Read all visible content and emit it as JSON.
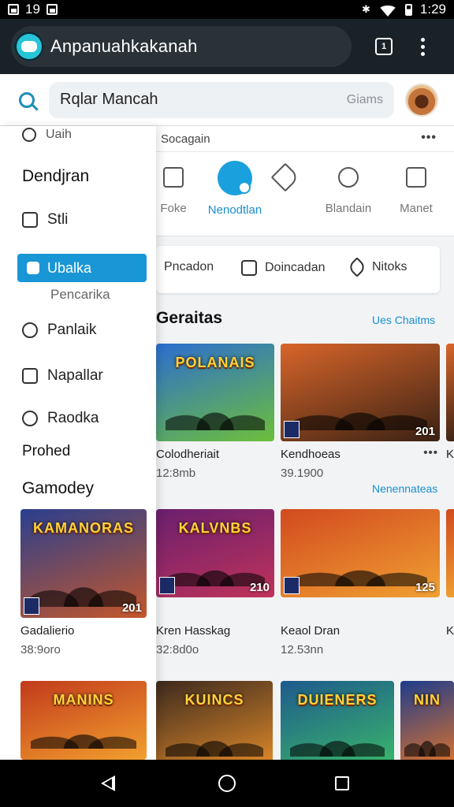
{
  "status_bar": {
    "time_left": "19",
    "time_right": "1:29"
  },
  "app_bar": {
    "title": "Anpanuahkakanah",
    "tab_count": "1"
  },
  "search": {
    "query": "Rqlar Mancah",
    "scope": "Giams"
  },
  "drawer": {
    "top_item": "Uaih",
    "heading1": "Dendjran",
    "item_stli": "Stli",
    "active_item": "Ubalka",
    "sub_item": "Pencarika",
    "item_panlaik": "Panlaik",
    "item_napallar": "Napallar",
    "item_raodka": "Raodka",
    "heading2": "Prohed",
    "section": "Gamodey"
  },
  "quick_card": {
    "title": "Socagain",
    "actions": [
      "Foke",
      "Nenodtlan",
      "",
      "Blandain",
      "Manet"
    ]
  },
  "chips": [
    "Pncadon",
    "Doincadan",
    "Nitoks"
  ],
  "featured": {
    "title": "Geraitas",
    "link": "Ues Chaitms",
    "sub_link": "Nenennateas"
  },
  "games": [
    {
      "art_title": "POLANAIS",
      "year": "",
      "name": "Colodheriait",
      "meta": "12:8mb",
      "colors": [
        "#2d6ed0",
        "#6cbf3a"
      ]
    },
    {
      "art_title": "",
      "year": "201",
      "name": "Kendhoeas",
      "meta": "39.1900",
      "colors": [
        "#d8652a",
        "#3a2214"
      ]
    },
    {
      "art_title": "KAMANORAS",
      "year": "201",
      "name": "Gadalierio",
      "meta": "38:9oro",
      "colors": [
        "#2a3f8f",
        "#c4572a"
      ]
    },
    {
      "art_title": "KALVNBS",
      "year": "210",
      "name": "Kren Hasskag",
      "meta": "32:8d0o",
      "colors": [
        "#6a1f6e",
        "#c0335a"
      ]
    },
    {
      "art_title": "",
      "year": "125",
      "name": "Keaol Dran",
      "meta": "12.53nn",
      "colors": [
        "#d24a1f",
        "#f0a032"
      ]
    },
    {
      "art_title": "MANINS",
      "year": "",
      "name": "",
      "meta": "",
      "colors": [
        "#c23a1c",
        "#f2a02e"
      ]
    },
    {
      "art_title": "KUINCS",
      "year": "",
      "name": "",
      "meta": "",
      "colors": [
        "#3c2a1e",
        "#e08a2a"
      ]
    },
    {
      "art_title": "DUIENERS",
      "year": "",
      "name": "",
      "meta": "",
      "colors": [
        "#1e5a8c",
        "#3ab86a"
      ]
    },
    {
      "art_title": "NIN",
      "year": "",
      "name": "",
      "meta": "",
      "colors": [
        "#1e3c8c",
        "#e0742a"
      ]
    }
  ],
  "peek_labels": {
    "row1": "K",
    "row2": "K"
  }
}
